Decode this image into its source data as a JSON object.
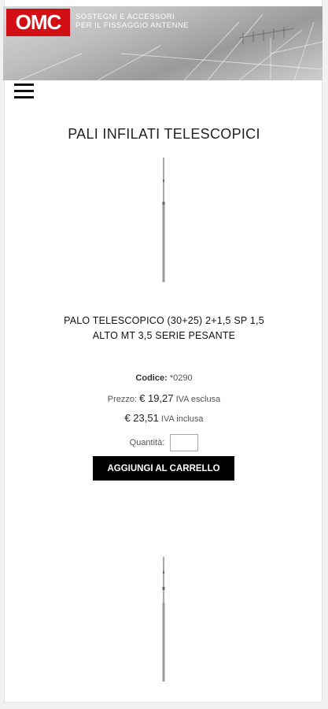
{
  "header": {
    "logo_text": "OMC",
    "tagline_line1": "SOSTEGNI E ACCESSORI",
    "tagline_line2": "PER IL FISSAGGIO ANTENNE",
    "brand_color": "#d20f14"
  },
  "nav": {
    "menu_icon": "hamburger-icon"
  },
  "category": {
    "title": "PALI INFILATI TELESCOPICI"
  },
  "product": {
    "name_line1": "PALO TELESCOPICO (30+25) 2+1,5 SP 1,5",
    "name_line2": "ALTO MT 3,5 SERIE PESANTE",
    "code_label": "Codice:",
    "code_value": "*0290",
    "price_label": "Prezzo:",
    "price_ex_vat": "€ 19,27",
    "price_ex_vat_note": "IVA esclusa",
    "price_inc_vat": "€ 23,51",
    "price_inc_vat_note": "IVA inclusa",
    "quantity_label": "Quantità:",
    "quantity_value": "",
    "add_to_cart_label": "AGGIUNGI AL CARRELLO"
  }
}
